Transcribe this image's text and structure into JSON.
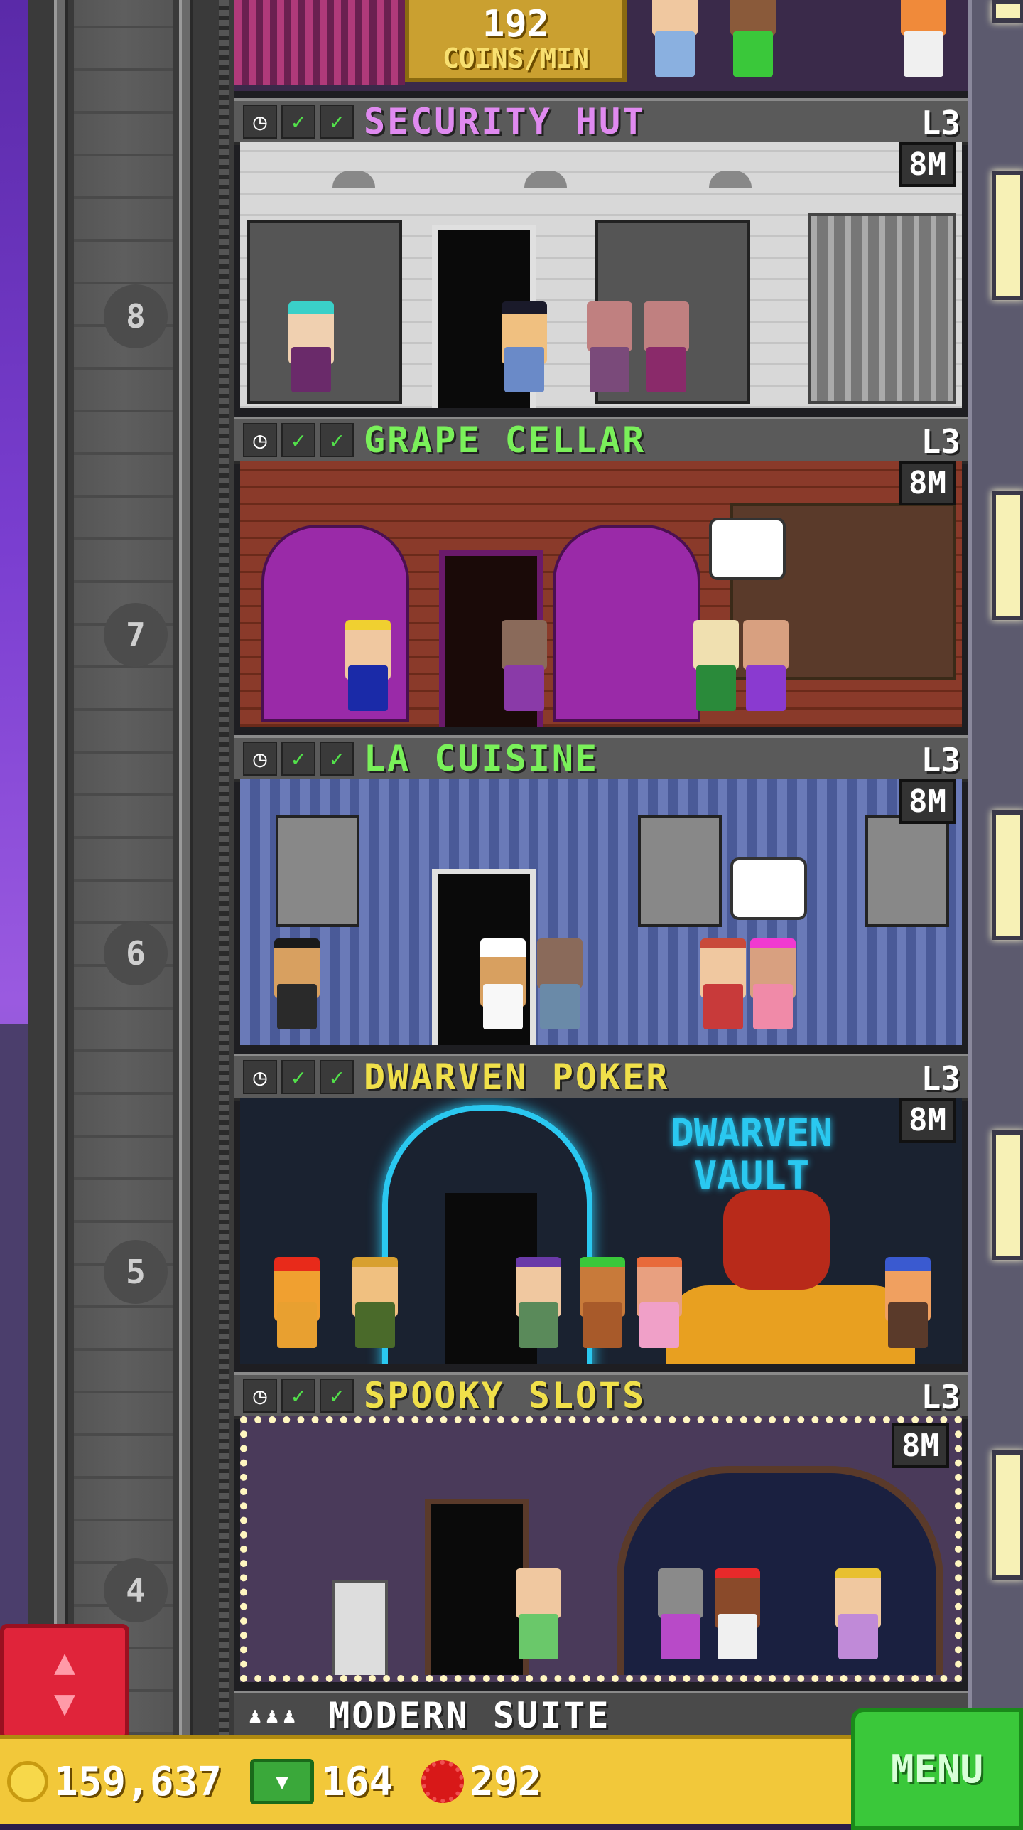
{
  "top_floor": {
    "coins_rate_value": "192",
    "coins_rate_unit": "COINS/MIN"
  },
  "floors": [
    {
      "number": "8",
      "name": "SECURITY HUT",
      "name_color": "#e08af0",
      "level": "L3",
      "stock": "8M"
    },
    {
      "number": "7",
      "name": "GRAPE CELLAR",
      "name_color": "#7af05a",
      "level": "L3",
      "stock": "8M"
    },
    {
      "number": "6",
      "name": "LA CUISINE",
      "name_color": "#7af05a",
      "level": "L3",
      "stock": "8M"
    },
    {
      "number": "5",
      "name": "DWARVEN POKER",
      "name_color": "#f0e04a",
      "level": "L3",
      "stock": "8M"
    },
    {
      "number": "4",
      "name": "SPOOKY SLOTS",
      "name_color": "#f0e04a",
      "level": "L3",
      "stock": "8M"
    }
  ],
  "room_signs": {
    "dwarven_sign_line1": "DWARVEN",
    "dwarven_sign_line2": "VAULT"
  },
  "next_floor": {
    "name": "MODERN SUITE"
  },
  "resources": {
    "coins": "159,637",
    "bux": "164",
    "gems": "292"
  },
  "buttons": {
    "menu_label": "MENU",
    "elevator_symbol": "▲▼"
  },
  "colors": {
    "coin": "#f7d84a",
    "bux": "#3aa83a",
    "gem": "#d81818",
    "menu": "#3ac83a",
    "elevator_button": "#e0243a"
  }
}
